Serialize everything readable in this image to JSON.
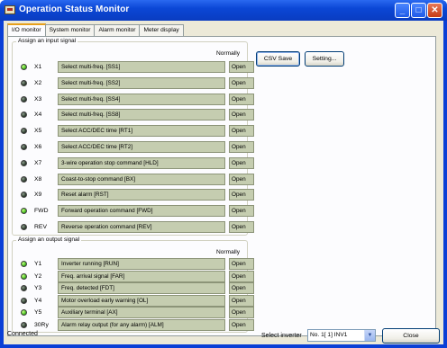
{
  "window": {
    "title": "Operation Status Monitor",
    "minimize": "_",
    "maximize": "□",
    "close": "✕"
  },
  "tabs": [
    "I/O monitor",
    "System monitor",
    "Alarm monitor",
    "Meter display"
  ],
  "input_group": {
    "title": "Assign an input signal",
    "normally_header": "Normally",
    "rows": [
      {
        "led": "on",
        "signal": "X1",
        "description": "Select multi-freq. [SS1]",
        "normally": "Open"
      },
      {
        "led": "off",
        "signal": "X2",
        "description": "Select multi-freq. [SS2]",
        "normally": "Open"
      },
      {
        "led": "off",
        "signal": "X3",
        "description": "Select multi-freq. [SS4]",
        "normally": "Open"
      },
      {
        "led": "off",
        "signal": "X4",
        "description": "Select multi-freq. [SS8]",
        "normally": "Open"
      },
      {
        "led": "off",
        "signal": "X5",
        "description": "Select ACC/DEC time [RT1]",
        "normally": "Open"
      },
      {
        "led": "off",
        "signal": "X6",
        "description": "Select ACC/DEC time [RT2]",
        "normally": "Open"
      },
      {
        "led": "off",
        "signal": "X7",
        "description": "3-wire operation stop command [HLD]",
        "normally": "Open"
      },
      {
        "led": "off",
        "signal": "X8",
        "description": "Coast-to-stop command [BX]",
        "normally": "Open"
      },
      {
        "led": "off",
        "signal": "X9",
        "description": "Reset alarm [RST]",
        "normally": "Open"
      },
      {
        "led": "on",
        "signal": "FWD",
        "description": "Forward operation command [FWD]",
        "normally": "Open"
      },
      {
        "led": "off",
        "signal": "REV",
        "description": "Reverse operation command [REV]",
        "normally": "Open"
      }
    ]
  },
  "output_group": {
    "title": "Assign an output signal",
    "normally_header": "Normally",
    "rows": [
      {
        "led": "on",
        "signal": "Y1",
        "description": "Inverter running [RUN]",
        "normally": "Open"
      },
      {
        "led": "on",
        "signal": "Y2",
        "description": "Freq. arrival signal [FAR]",
        "normally": "Open"
      },
      {
        "led": "off",
        "signal": "Y3",
        "description": "Freq. detected [FDT]",
        "normally": "Open"
      },
      {
        "led": "off",
        "signal": "Y4",
        "description": "Motor overload early warning [OL]",
        "normally": "Open"
      },
      {
        "led": "on",
        "signal": "Y5",
        "description": "Auxiliary terminal [AX]",
        "normally": "Open"
      },
      {
        "led": "off",
        "signal": "30Ry",
        "description": "Alarm relay output (for any alarm) [ALM]",
        "normally": "Open"
      }
    ]
  },
  "buttons": {
    "csv_save": "CSV Save",
    "setting": "Setting...",
    "close": "Close"
  },
  "status": {
    "text": "Connected",
    "select_label": "Select inverter",
    "select_value": "No. 1[ 1] INV1"
  },
  "colors": {
    "title_bar": "#0b47d6",
    "led_on": "#48c020",
    "led_off": "#304030",
    "field_bg": "#c5cdb0"
  }
}
